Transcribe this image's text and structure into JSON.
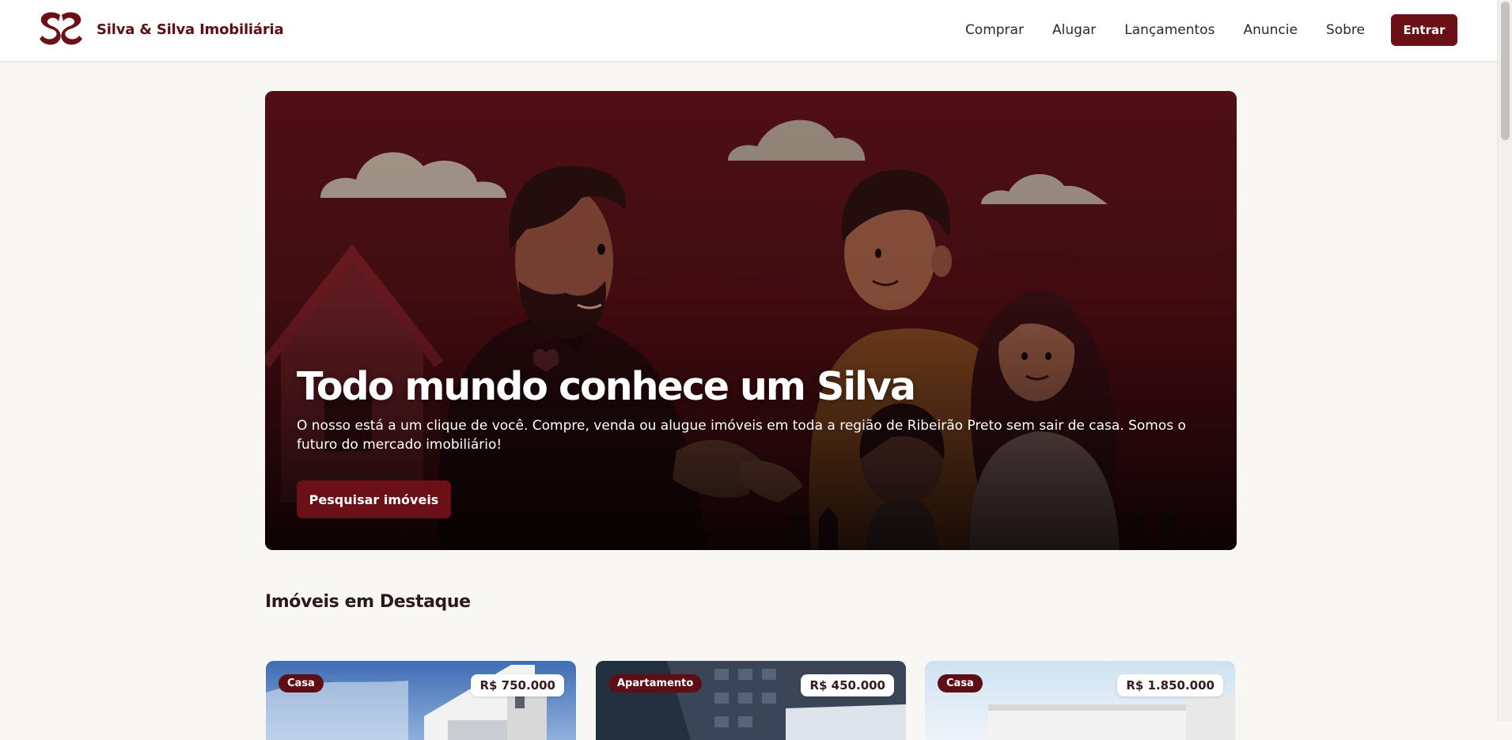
{
  "header": {
    "brand_name": "Silva & Silva Imobiliária",
    "nav": [
      "Comprar",
      "Alugar",
      "Lançamentos",
      "Anuncie",
      "Sobre"
    ],
    "login_label": "Entrar"
  },
  "hero": {
    "title": "Todo mundo conhece um Silva",
    "text": "O nosso está a um clique de você. Compre, venda ou alugue imóveis em toda a região de Ribeirão Preto sem sair de casa. Somos o futuro do mercado imobiliário!",
    "button_label": "Pesquisar imóveis"
  },
  "featured": {
    "title": "Imóveis em Destaque",
    "cards": [
      {
        "type": "Casa",
        "price": "R$ 750.000"
      },
      {
        "type": "Apartamento",
        "price": "R$ 450.000"
      },
      {
        "type": "Casa",
        "price": "R$ 1.850.000"
      }
    ]
  },
  "colors": {
    "brand": "#6a1016",
    "brand_dark": "#5e0f16",
    "background": "#f8f7f4"
  },
  "icons": {
    "logo": "ss-monogram-logo"
  }
}
